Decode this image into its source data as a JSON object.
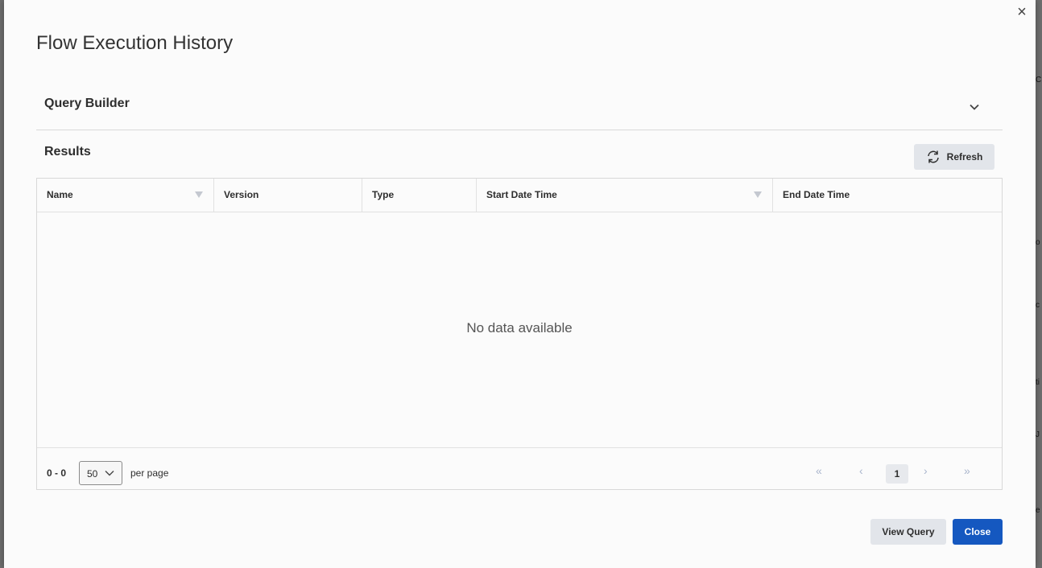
{
  "modal": {
    "title": "Flow Execution History",
    "close_icon_glyph": "×"
  },
  "query_builder": {
    "label": "Query Builder"
  },
  "results": {
    "label": "Results",
    "refresh_label": "Refresh"
  },
  "table": {
    "columns": [
      {
        "label": "Name",
        "sortable": true
      },
      {
        "label": "Version",
        "sortable": false
      },
      {
        "label": "Type",
        "sortable": false
      },
      {
        "label": "Start Date Time",
        "sortable": true
      },
      {
        "label": "End Date Time",
        "sortable": false
      }
    ],
    "empty_message": "No data available"
  },
  "pagination": {
    "range": "0 - 0",
    "per_page_value": "50",
    "per_page_label": "per page",
    "first_glyph": "«",
    "prev_glyph": "‹",
    "next_glyph": "›",
    "last_glyph": "»",
    "current_page": "1"
  },
  "footer": {
    "view_query_label": "View Query",
    "close_label": "Close"
  },
  "colors": {
    "primary": "#1558c0",
    "secondary_button": "#e2e5ea",
    "pager_disabled": "#a9b5cc"
  }
}
